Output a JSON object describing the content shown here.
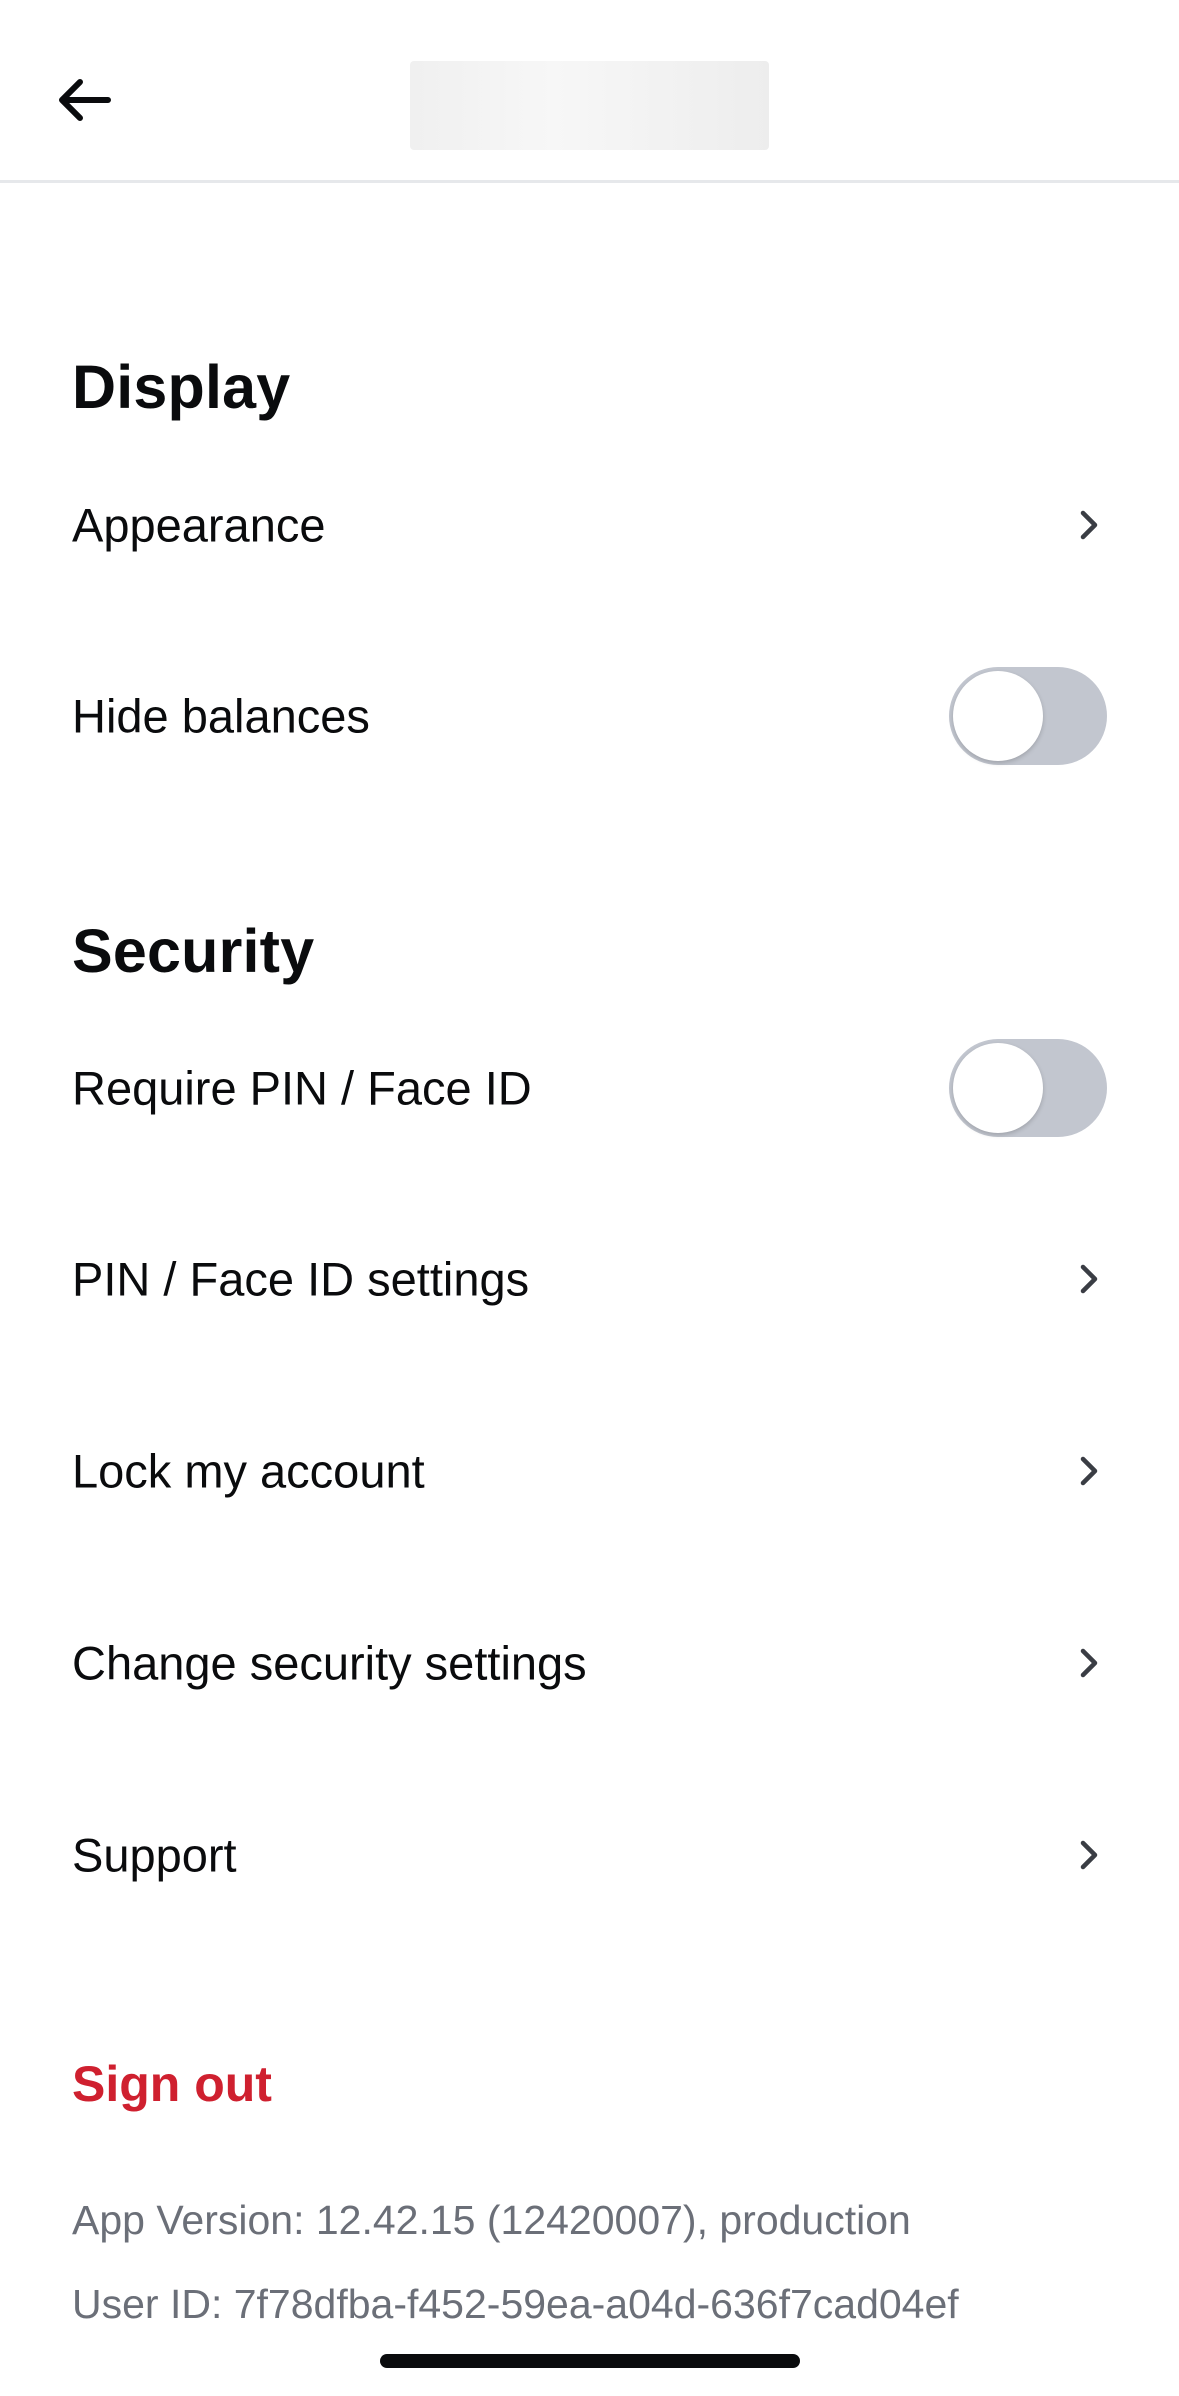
{
  "header": {
    "back_icon": "arrow-left-icon"
  },
  "display": {
    "title": "Display",
    "appearance_label": "Appearance",
    "hide_balances_label": "Hide balances",
    "hide_balances_on": false
  },
  "security": {
    "title": "Security",
    "require_pin_label": "Require PIN / Face ID",
    "require_pin_on": false,
    "pin_settings_label": "PIN / Face ID settings",
    "lock_account_label": "Lock my account",
    "change_security_label": "Change security settings"
  },
  "support_label": "Support",
  "sign_out_label": "Sign out",
  "app_version": "App Version: 12.42.15 (12420007), production",
  "user_id": "User ID: 7f78dfba-f452-59ea-a04d-636f7cad04ef",
  "colors": {
    "danger": "#cf202f",
    "toggle_off": "#c2c6cf",
    "muted_text": "#6b6f78"
  }
}
